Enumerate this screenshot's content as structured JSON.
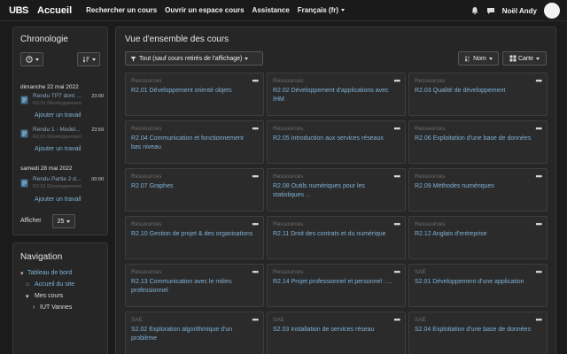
{
  "navbar": {
    "logo_text": "UBS",
    "site_name": "Accueil",
    "links": [
      "Rechercher un cours",
      "Ouvrir un espace cours",
      "Assistance",
      "Français (fr)"
    ],
    "user_name": "Noël Andy"
  },
  "timeline": {
    "title": "Chronologie",
    "groups": [
      {
        "day": "dimanche 22 mai 2022",
        "items": [
          {
            "title": "Rendu TP7 dont E...",
            "sub": "R2.01 Développement",
            "time": "23:00",
            "action": "Ajouter un travail"
          },
          {
            "title": "Rendu 1 - Model...",
            "sub": "R2.01 Développement",
            "time": "23:59",
            "action": "Ajouter un travail"
          }
        ]
      },
      {
        "day": "samedi 28 mai 2022",
        "items": [
          {
            "title": "Rendu Partie 2 d...",
            "sub": "R2.01 Développement",
            "time": "00:00",
            "action": "Ajouter un travail"
          }
        ]
      }
    ],
    "show_label": "Afficher",
    "show_value": "25"
  },
  "navigation": {
    "title": "Navigation",
    "dashboard": "Tableau de bord",
    "home": "Accueil du site",
    "my_courses": "Mes cours",
    "iut": "IUT Vannes"
  },
  "overview": {
    "title": "Vue d'ensemble des cours",
    "filter": "Tout (sauf cours retirés de l'affichage)",
    "sort": "Nom",
    "view": "Carte",
    "menu_glyph": "•••",
    "courses": [
      {
        "category": "Ressources",
        "name": "R2.01 Développement orienté objets"
      },
      {
        "category": "Ressources",
        "name": "R2.02 Développement d'applications avec IHM"
      },
      {
        "category": "Ressources",
        "name": "R2.03 Qualité de développement"
      },
      {
        "category": "Ressources",
        "name": "R2.04 Communication et fonctionnement bas niveau"
      },
      {
        "category": "Ressources",
        "name": "R2.05 Introduction aux services réseaux"
      },
      {
        "category": "Ressources",
        "name": "R2.06 Exploitation d'une base de données"
      },
      {
        "category": "Ressources",
        "name": "R2.07 Graphes"
      },
      {
        "category": "Ressources",
        "name": "R2.08 Outils numériques pour les statistiques ..."
      },
      {
        "category": "Ressources",
        "name": "R2.09 Méthodes numériques"
      },
      {
        "category": "Ressources",
        "name": "R2.10 Gestion de projet & des organisations"
      },
      {
        "category": "Ressources",
        "name": "R2.11 Droit des contrats et du numérique"
      },
      {
        "category": "Ressources",
        "name": "R2.12 Anglais d'entreprise"
      },
      {
        "category": "Ressources",
        "name": "R2.13 Communication avec le milieu professionnel"
      },
      {
        "category": "Ressources",
        "name": "R2.14 Projet professionnel et personnel : ..."
      },
      {
        "category": "SAE",
        "name": "S2.01 Développement d'une application"
      },
      {
        "category": "SAE",
        "name": "S2.02 Exploration algorithmique d'un problème"
      },
      {
        "category": "SAE",
        "name": "S2.03 Installation de services réseau"
      },
      {
        "category": "SAE",
        "name": "S2.04 Exploitation d'une base de données"
      }
    ]
  }
}
